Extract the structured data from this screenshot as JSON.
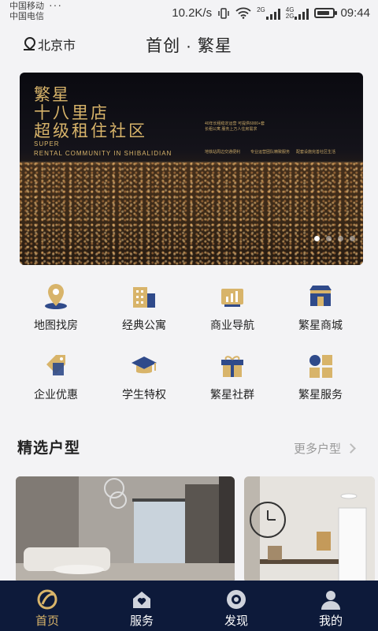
{
  "status_bar": {
    "carrier1": "中国移动",
    "carrier2": "中国电信",
    "more": "···",
    "speed": "10.2K/s",
    "net_2g": "2G",
    "net_4g": "4G",
    "net_2g_b": "2G",
    "time": "09:44",
    "battery_level": 0.85
  },
  "header": {
    "city": "北京市",
    "title": "首创 · 繁星"
  },
  "banner": {
    "line1": "繁星",
    "line2": "十八里店",
    "line3": "超级租住社区",
    "en1": "SUPER",
    "en2": "RENTAL COMMUNITY IN SHIBALIDIAN",
    "small1": "40年长租稳定运营 可提供6000+套长租公寓 服务上万人住房需求",
    "small2": "地铁站周边交通便利",
    "small3": "专业运营团队精致服务",
    "small4": "配套设施完善社区生活",
    "slide_count": 4,
    "active_slide": 0
  },
  "grid": [
    {
      "label": "地图找房",
      "icon": "map-pin-icon"
    },
    {
      "label": "经典公寓",
      "icon": "building-icon"
    },
    {
      "label": "商业导航",
      "icon": "chart-icon"
    },
    {
      "label": "繁星商城",
      "icon": "shop-icon"
    },
    {
      "label": "企业优惠",
      "icon": "tag-icon"
    },
    {
      "label": "学生特权",
      "icon": "graduation-cap-icon"
    },
    {
      "label": "繁星社群",
      "icon": "gift-icon"
    },
    {
      "label": "繁星服务",
      "icon": "service-grid-icon"
    }
  ],
  "section": {
    "title": "精选户型",
    "more": "更多户型"
  },
  "nav": [
    {
      "label": "首页",
      "icon": "home-icon",
      "active": true
    },
    {
      "label": "服务",
      "icon": "heart-house-icon",
      "active": false
    },
    {
      "label": "发现",
      "icon": "discover-icon",
      "active": false
    },
    {
      "label": "我的",
      "icon": "user-icon",
      "active": false
    }
  ],
  "colors": {
    "gold": "#d8b46a",
    "navy": "#0d1a3a",
    "blue_accent": "#2f4a8a"
  }
}
